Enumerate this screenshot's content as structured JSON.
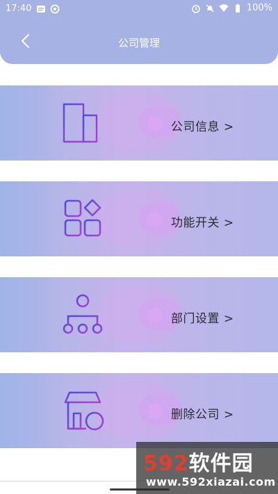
{
  "status_bar": {
    "time": "17:40",
    "battery": "100%"
  },
  "header": {
    "title": "公司管理"
  },
  "menu": [
    {
      "label": "公司信息 >",
      "icon": "building-icon"
    },
    {
      "label": "功能开关 >",
      "icon": "apps-grid-icon"
    },
    {
      "label": "部门设置 >",
      "icon": "org-tree-icon"
    },
    {
      "label": "删除公司 >",
      "icon": "store-remove-icon"
    }
  ],
  "watermark": {
    "brand_num": "592",
    "brand_text": "软件园",
    "url": "www.592xiazai.com"
  },
  "colors": {
    "header": "#a6b1e4",
    "icon_gradient_start": "#4b4fd6",
    "icon_gradient_end": "#b23fd0"
  }
}
